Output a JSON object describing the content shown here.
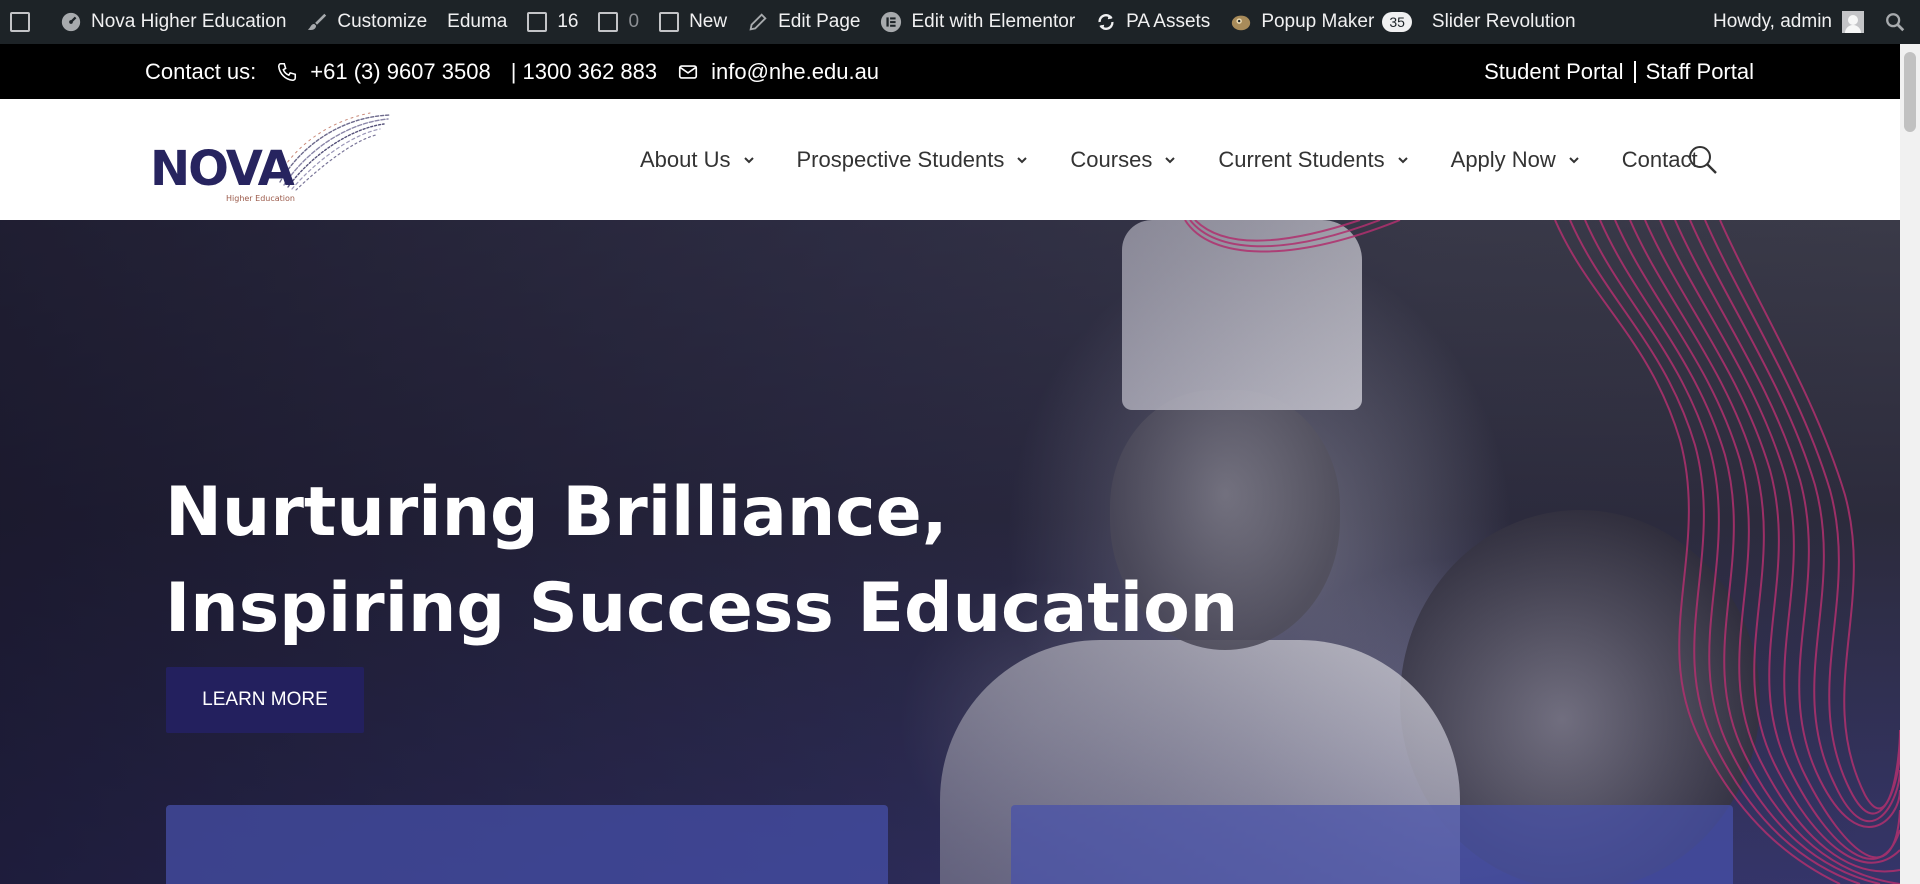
{
  "admin_bar": {
    "site_name": "Nova Higher Education",
    "customize": "Customize",
    "theme": "Eduma",
    "updates": "16",
    "comments": "0",
    "new": "New",
    "edit_page": "Edit Page",
    "edit_elementor": "Edit with Elementor",
    "pa_assets": "PA Assets",
    "popup_maker": "Popup Maker",
    "popup_count": "35",
    "slider_revolution": "Slider Revolution",
    "howdy": "Howdy, admin"
  },
  "contact_bar": {
    "label": "Contact us:",
    "phone": "+61 (3) 9607 3508",
    "phone_alt": "| 1300 362 883",
    "email": "info@nhe.edu.au",
    "student_portal": "Student Portal",
    "staff_portal": "Staff Portal"
  },
  "header": {
    "logo_text": "NOVA",
    "logo_subtext": "Higher Education",
    "nav": [
      {
        "label": "About Us",
        "dropdown": true
      },
      {
        "label": "Prospective Students",
        "dropdown": true
      },
      {
        "label": "Courses",
        "dropdown": true
      },
      {
        "label": "Current Students",
        "dropdown": true
      },
      {
        "label": "Apply Now",
        "dropdown": true
      },
      {
        "label": "Contact",
        "dropdown": false
      }
    ]
  },
  "hero": {
    "title_line1": "Nurturing Brilliance,",
    "title_line2": "Inspiring Success Education",
    "button": "LEARN MORE"
  },
  "colors": {
    "admin_bar_bg": "#1d2327",
    "contact_bar_bg": "#000000",
    "brand_navy": "#23205e",
    "wave_magenta": "#b0306e"
  },
  "icons": {
    "site": "dashboard-icon",
    "customize": "paintbrush-icon",
    "edit": "pencil-icon",
    "elementor": "elementor-icon",
    "pa_assets": "refresh-icon",
    "popup": "popup-maker-icon",
    "search": "search-icon",
    "phone": "phone-icon",
    "email": "envelope-icon"
  }
}
